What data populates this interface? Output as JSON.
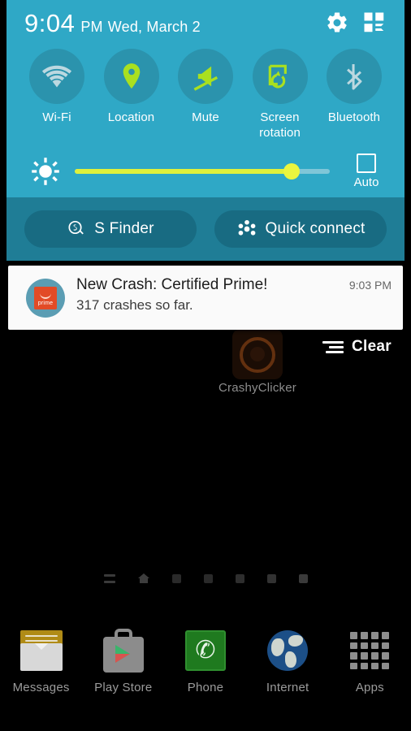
{
  "statusbar": {
    "time": "9:04",
    "ampm": "PM",
    "date": "Wed, March 2",
    "settings_icon": "gear-icon",
    "edit_quicksettings_icon": "quick-settings-grid-icon"
  },
  "quick_settings": {
    "toggles": [
      {
        "label": "Wi-Fi",
        "icon": "wifi-icon",
        "state": "off"
      },
      {
        "label": "Location",
        "icon": "location-pin-icon",
        "state": "on"
      },
      {
        "label": "Mute",
        "icon": "mute-icon",
        "state": "on"
      },
      {
        "label": "Screen rotation",
        "icon": "screen-rotation-icon",
        "state": "on"
      },
      {
        "label": "Bluetooth",
        "icon": "bluetooth-icon",
        "state": "off"
      }
    ],
    "brightness": {
      "icon": "brightness-sun-icon",
      "value_percent": 85,
      "auto_label": "Auto",
      "auto_checked": false
    },
    "actions": [
      {
        "label": "S Finder",
        "icon": "s-finder-search-icon"
      },
      {
        "label": "Quick connect",
        "icon": "quick-connect-icon"
      }
    ]
  },
  "notifications": {
    "items": [
      {
        "app_icon": "prime-app-icon",
        "app_badge_text": "prime",
        "title": "New Crash: Certified Prime!",
        "text": "317 crashes so far.",
        "time": "9:03 PM"
      }
    ],
    "clear_label": "Clear",
    "clear_icon": "clear-all-icon"
  },
  "homescreen": {
    "apps": [
      {
        "label": "CrashyClicker",
        "icon": "crashyclicker-icon"
      }
    ],
    "page_indicator": {
      "icons": [
        "pages-list-icon",
        "home-page-icon"
      ],
      "dots": 5,
      "current": 2
    }
  },
  "dock": {
    "items": [
      {
        "label": "Messages",
        "icon": "envelope-icon"
      },
      {
        "label": "Play Store",
        "icon": "play-store-icon"
      },
      {
        "label": "Phone",
        "icon": "phone-handset-icon"
      },
      {
        "label": "Internet",
        "icon": "globe-icon"
      },
      {
        "label": "Apps",
        "icon": "apps-grid-icon"
      }
    ]
  },
  "colors": {
    "panel_teal": "#2fa8c6",
    "panel_dark_teal": "#1f7d96",
    "toggle_circle": "#2b93ad",
    "accent_green": "#a9e020",
    "slider_green": "#dff13c",
    "toggle_off": "#bcd8e0",
    "card_bg": "#fafafa",
    "prime_orange": "#e24b26",
    "wallpaper": "#000000"
  }
}
